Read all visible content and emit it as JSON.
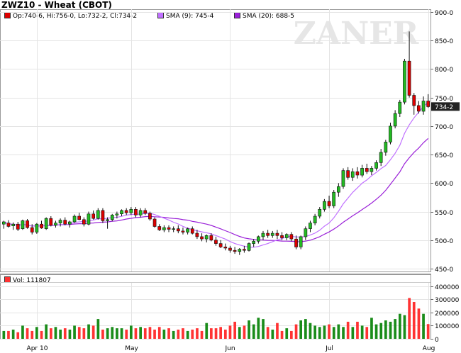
{
  "chart_data": [
    {
      "type": "candlestick",
      "title": "ZWZ10 - Wheat (CBOT)",
      "watermark": "ZANER",
      "legend": [
        {
          "name": "Op:740-6, Hi:756-0, Lo:732-2, Cl:734-2",
          "color": "#dd0000"
        },
        {
          "name": "SMA (9): 745-4",
          "color": "#c070ff"
        },
        {
          "name": "SMA (20): 688-5",
          "color": "#9a20d8"
        }
      ],
      "ylim": [
        445,
        905
      ],
      "y_ticks": [
        450,
        500,
        550,
        600,
        650,
        700,
        750,
        800,
        850,
        900
      ],
      "y_tick_labels": [
        "450-0",
        "500-0",
        "550-0",
        "600-0",
        "650-0",
        "700-0",
        "750-0",
        "800-0",
        "850-0",
        "900-0"
      ],
      "last_price_label": "734-2",
      "last_price": 734.25,
      "x_tick_labels": [
        "Apr 10",
        "May",
        "Jun",
        "Jul",
        "Aug"
      ],
      "x_tick_index": [
        7,
        27,
        48,
        69,
        90
      ],
      "colors": {
        "up": "#22bb22",
        "down": "#dd0000",
        "sma9": "#c070ff",
        "sma20": "#9a20d8"
      },
      "ohlc": [
        [
          528,
          534,
          520,
          532
        ],
        [
          530,
          535,
          522,
          524
        ],
        [
          525,
          531,
          518,
          528
        ],
        [
          528,
          532,
          516,
          519
        ],
        [
          520,
          536,
          518,
          534
        ],
        [
          534,
          537,
          520,
          522
        ],
        [
          522,
          528,
          510,
          514
        ],
        [
          514,
          530,
          511,
          528
        ],
        [
          528,
          534,
          520,
          521
        ],
        [
          520,
          540,
          518,
          538
        ],
        [
          538,
          542,
          524,
          526
        ],
        [
          526,
          534,
          522,
          530
        ],
        [
          530,
          538,
          524,
          535
        ],
        [
          535,
          540,
          526,
          528
        ],
        [
          528,
          534,
          522,
          532
        ],
        [
          532,
          545,
          530,
          542
        ],
        [
          542,
          548,
          535,
          536
        ],
        [
          536,
          540,
          524,
          528
        ],
        [
          528,
          550,
          526,
          546
        ],
        [
          546,
          552,
          536,
          538
        ],
        [
          538,
          556,
          536,
          552
        ],
        [
          552,
          556,
          530,
          534
        ],
        [
          534,
          540,
          520,
          536
        ],
        [
          536,
          546,
          533,
          544
        ],
        [
          544,
          550,
          538,
          546
        ],
        [
          546,
          554,
          542,
          552
        ],
        [
          552,
          556,
          544,
          548
        ],
        [
          548,
          558,
          544,
          554
        ],
        [
          554,
          558,
          540,
          544
        ],
        [
          544,
          556,
          540,
          552
        ],
        [
          552,
          556,
          544,
          547
        ],
        [
          547,
          550,
          534,
          537
        ],
        [
          537,
          540,
          522,
          524
        ],
        [
          524,
          528,
          516,
          518
        ],
        [
          518,
          526,
          514,
          522
        ],
        [
          522,
          526,
          514,
          519
        ],
        [
          519,
          524,
          514,
          520
        ],
        [
          520,
          526,
          512,
          516
        ],
        [
          516,
          522,
          510,
          514
        ],
        [
          514,
          522,
          510,
          520
        ],
        [
          520,
          524,
          510,
          512
        ],
        [
          512,
          518,
          502,
          506
        ],
        [
          506,
          512,
          498,
          502
        ],
        [
          502,
          510,
          496,
          508
        ],
        [
          508,
          512,
          498,
          500
        ],
        [
          500,
          506,
          490,
          494
        ],
        [
          494,
          500,
          486,
          488
        ],
        [
          488,
          494,
          482,
          486
        ],
        [
          486,
          490,
          478,
          482
        ],
        [
          482,
          488,
          476,
          480
        ],
        [
          480,
          486,
          474,
          484
        ],
        [
          484,
          490,
          478,
          482
        ],
        [
          482,
          496,
          480,
          494
        ],
        [
          494,
          502,
          488,
          498
        ],
        [
          498,
          508,
          494,
          506
        ],
        [
          506,
          516,
          500,
          512
        ],
        [
          512,
          518,
          504,
          508
        ],
        [
          508,
          516,
          504,
          512
        ],
        [
          512,
          518,
          502,
          508
        ],
        [
          508,
          514,
          500,
          504
        ],
        [
          504,
          512,
          500,
          510
        ],
        [
          510,
          514,
          498,
          502
        ],
        [
          502,
          508,
          484,
          488
        ],
        [
          488,
          508,
          484,
          506
        ],
        [
          506,
          524,
          500,
          520
        ],
        [
          520,
          534,
          514,
          530
        ],
        [
          530,
          546,
          526,
          542
        ],
        [
          542,
          558,
          538,
          554
        ],
        [
          554,
          572,
          550,
          568
        ],
        [
          568,
          578,
          556,
          560
        ],
        [
          560,
          588,
          556,
          584
        ],
        [
          584,
          600,
          576,
          594
        ],
        [
          594,
          626,
          590,
          622
        ],
        [
          622,
          628,
          606,
          610
        ],
        [
          610,
          626,
          604,
          620
        ],
        [
          620,
          628,
          608,
          614
        ],
        [
          614,
          632,
          610,
          626
        ],
        [
          626,
          634,
          616,
          620
        ],
        [
          620,
          630,
          614,
          626
        ],
        [
          626,
          640,
          622,
          636
        ],
        [
          636,
          660,
          630,
          654
        ],
        [
          654,
          676,
          648,
          672
        ],
        [
          672,
          706,
          668,
          700
        ],
        [
          700,
          728,
          696,
          722
        ],
        [
          722,
          746,
          716,
          742
        ],
        [
          742,
          818,
          738,
          814
        ],
        [
          814,
          866,
          750,
          754
        ],
        [
          754,
          758,
          720,
          736
        ],
        [
          736,
          744,
          722,
          726
        ],
        [
          726,
          752,
          720,
          744
        ],
        [
          744,
          756,
          732,
          734
        ]
      ],
      "volume": {
        "legend": "Vol: 111807",
        "ylim": [
          0,
          420000
        ],
        "y_ticks": [
          0,
          100000,
          200000,
          300000,
          400000
        ],
        "y_tick_labels": [
          "0",
          "100000",
          "200000",
          "300000",
          "400000"
        ],
        "values": [
          60000,
          60000,
          70000,
          50000,
          100000,
          80000,
          60000,
          90000,
          60000,
          110000,
          80000,
          90000,
          70000,
          80000,
          70000,
          100000,
          90000,
          80000,
          110000,
          100000,
          150000,
          70000,
          80000,
          90000,
          80000,
          80000,
          70000,
          100000,
          80000,
          90000,
          80000,
          90000,
          70000,
          90000,
          70000,
          80000,
          60000,
          70000,
          80000,
          60000,
          70000,
          80000,
          60000,
          120000,
          80000,
          80000,
          90000,
          70000,
          100000,
          130000,
          90000,
          100000,
          140000,
          110000,
          160000,
          150000,
          90000,
          70000,
          120000,
          60000,
          80000,
          60000,
          110000,
          140000,
          150000,
          120000,
          100000,
          90000,
          100000,
          110000,
          90000,
          110000,
          90000,
          130000,
          90000,
          130000,
          100000,
          90000,
          160000,
          110000,
          120000,
          140000,
          130000,
          150000,
          190000,
          180000,
          310000,
          280000,
          230000,
          190000,
          111807
        ],
        "colors": {
          "up": "#1a8c1a",
          "down": "#ff3333",
          "flat": "#1a3a9c"
        }
      }
    }
  ]
}
